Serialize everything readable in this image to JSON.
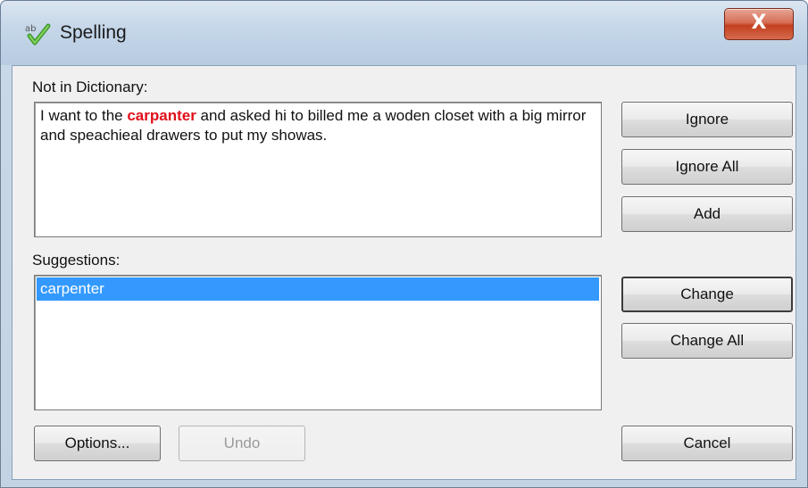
{
  "window": {
    "title": "Spelling",
    "close_label": "X"
  },
  "not_in_dictionary": {
    "label": "Not in Dictionary:",
    "text_before": "I want to the ",
    "misspelled_word": "carpanter",
    "text_after": " and asked hi to billed me a woden closet with a big mirror and speachieal drawers to put my showas."
  },
  "suggestions": {
    "label": "Suggestions:",
    "items": [
      "carpenter"
    ],
    "selected_index": 0
  },
  "buttons": {
    "ignore": "Ignore",
    "ignore_all": "Ignore All",
    "add": "Add",
    "change": "Change",
    "change_all": "Change All",
    "options": "Options...",
    "undo": "Undo",
    "cancel": "Cancel"
  },
  "colors": {
    "misspelled": "#e0101a",
    "selection": "#3399ff",
    "close_button": "#c2401f"
  },
  "icons": {
    "app": "spelling-check-icon",
    "close": "close-icon"
  }
}
